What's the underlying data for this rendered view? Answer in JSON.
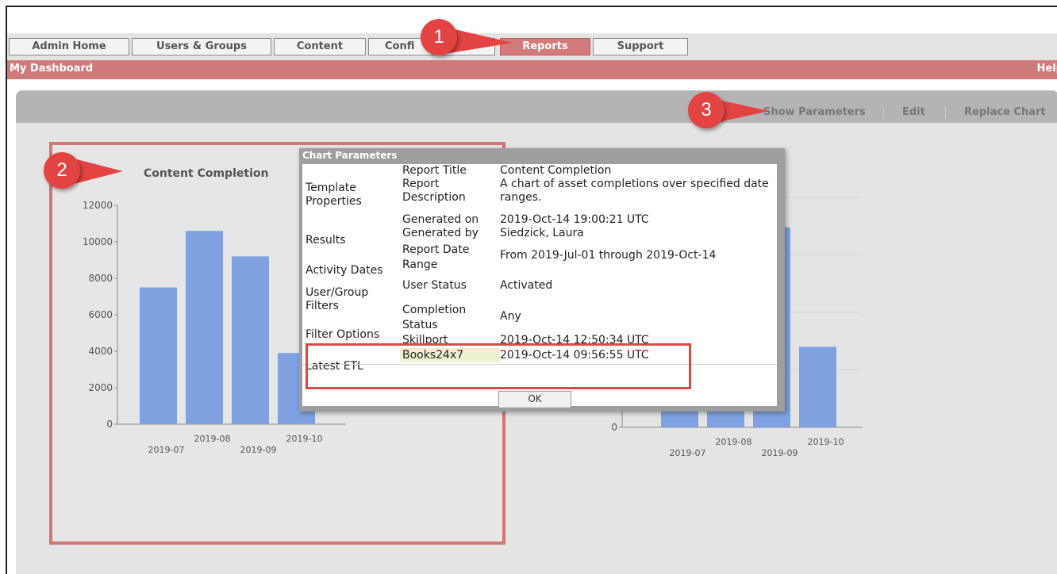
{
  "tabs": [
    {
      "label": "Admin Home",
      "active": false
    },
    {
      "label": "Users & Groups",
      "active": false
    },
    {
      "label": "Content",
      "active": false
    },
    {
      "label": "Confi",
      "active": false
    },
    {
      "label": "Reports",
      "active": true
    },
    {
      "label": "Support",
      "active": false
    }
  ],
  "dashboard": {
    "title": "My Dashboard",
    "help": "Help"
  },
  "panel_links": {
    "show_parameters": "Show Parameters",
    "edit": "Edit",
    "replace_chart": "Replace Chart"
  },
  "callouts": [
    "1",
    "2",
    "3"
  ],
  "colors": {
    "accent": "#cf7a7a",
    "bar": "#7ea2e0",
    "callout": "#e24343",
    "highlight_box": "#e24747"
  },
  "chart_data": [
    {
      "type": "bar",
      "title": "Content Completion",
      "categories": [
        "2019-07",
        "2019-08",
        "2019-09",
        "2019-10"
      ],
      "values": [
        7500,
        10600,
        9200,
        3900
      ],
      "ylim": [
        0,
        12000
      ],
      "yticks": [
        "0",
        "2000",
        "4000",
        "6000",
        "8000",
        "10000",
        "12000"
      ],
      "grid": false
    },
    {
      "type": "bar",
      "title": "",
      "categories": [
        "2019-07",
        "2019-08",
        "2019-09",
        "2019-10"
      ],
      "values": [
        3000,
        3000,
        8700,
        3500
      ],
      "ylim": [
        0,
        10000
      ],
      "yticks": [
        "0"
      ],
      "grid": true
    }
  ],
  "dialog": {
    "title": "Chart Parameters",
    "rows": [
      {
        "section": "Template Properties",
        "label": "Report Title",
        "value": "Content Completion"
      },
      {
        "section": "",
        "label": "Report Description",
        "value": "A chart of asset completions over specified date ranges."
      },
      {
        "section": "Results",
        "label": "Generated on",
        "value": "2019-Oct-14 19:00:21 UTC"
      },
      {
        "section": "",
        "label": "Generated by",
        "value": "Siedzick, Laura"
      },
      {
        "section": "Activity Dates",
        "label": "Report Date Range",
        "value": "From 2019-Jul-01 through 2019-Oct-14"
      },
      {
        "section": "User/Group Filters",
        "label": "User Status",
        "value": "Activated"
      },
      {
        "section": "Filter Options",
        "label": "Completion Status",
        "value": "Any"
      },
      {
        "section": "Latest ETL",
        "label": "Skillport",
        "value": "2019-Oct-14 12:50:34 UTC"
      },
      {
        "section": "",
        "label": "Books24x7",
        "value": "2019-Oct-14 09:56:55 UTC"
      }
    ],
    "ok_label": "OK"
  }
}
